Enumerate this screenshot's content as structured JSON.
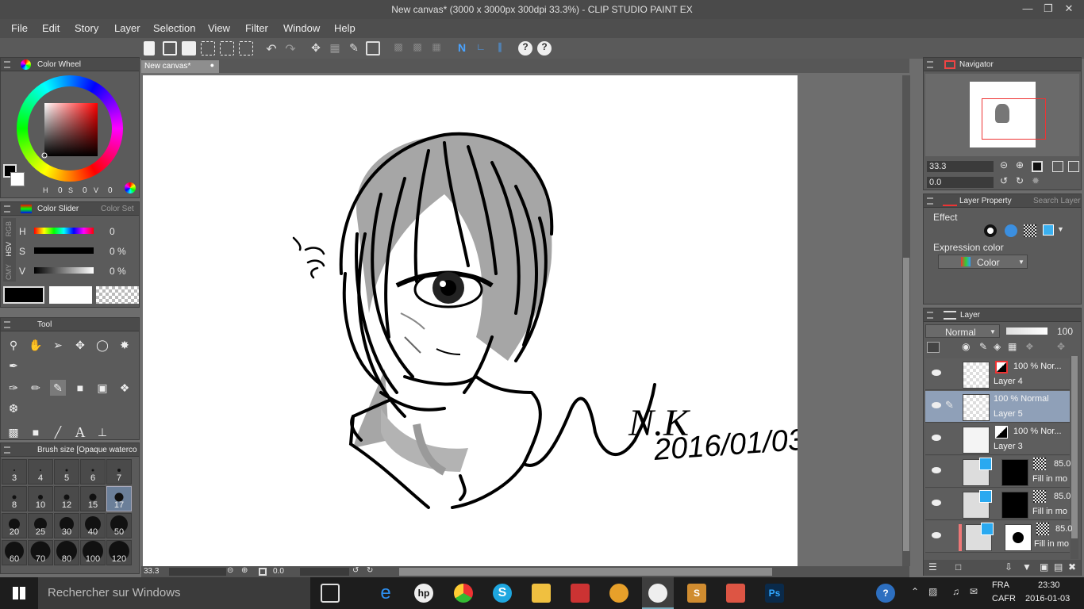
{
  "window": {
    "title": "New canvas* (3000 x 3000px 300dpi 33.3%)  - CLIP STUDIO PAINT EX"
  },
  "menu": [
    "File",
    "Edit",
    "Story",
    "Layer",
    "Selection",
    "View",
    "Filter",
    "Window",
    "Help"
  ],
  "canvas_tab": {
    "label": "New canvas*"
  },
  "color_wheel": {
    "title": "Color Wheel",
    "h_label": "H",
    "h": "0",
    "s_label": "S",
    "s": "0",
    "v_label": "V",
    "v": "0"
  },
  "color_slider": {
    "title": "Color Slider",
    "alt_tab": "Color Set",
    "side_tabs": [
      "RGB",
      "HSV",
      "CMY"
    ],
    "rows": [
      {
        "label": "H",
        "value": "0"
      },
      {
        "label": "S",
        "value": "0 %"
      },
      {
        "label": "V",
        "value": "0 %"
      }
    ]
  },
  "tool_panel": {
    "title": "Tool"
  },
  "brush_size": {
    "title": "Brush size [Opaque watercolor]",
    "sizes": [
      "3",
      "4",
      "5",
      "6",
      "7",
      "8",
      "10",
      "12",
      "15",
      "17",
      "20",
      "25",
      "30",
      "40",
      "50",
      "60",
      "70",
      "80",
      "100",
      "120"
    ],
    "selected": "17"
  },
  "canvas_status": {
    "zoom": "33.3",
    "angle": "0.0"
  },
  "drawing_text": {
    "signature": "N.K",
    "date": "2016/01/03"
  },
  "navigator": {
    "title": "Navigator",
    "zoom": "33.3",
    "angle": "0.0"
  },
  "layer_property": {
    "title": "Layer Property",
    "alt_tab": "Search Layer",
    "effect_label": "Effect",
    "expr_label": "Expression color",
    "expr_value": "Color"
  },
  "layer_panel": {
    "title": "Layer",
    "blend": "Normal",
    "opacity": "100"
  },
  "layers": [
    {
      "top": "100 %  Nor...",
      "name": "Layer 4"
    },
    {
      "top": "100 %  Normal",
      "name": "Layer 5"
    },
    {
      "top": "100 %  Nor...",
      "name": "Layer 3"
    },
    {
      "top": "85.0",
      "name": "Fill in mo"
    },
    {
      "top": "85.0",
      "name": "Fill in mo"
    },
    {
      "top": "85.0",
      "name": "Fill in mo"
    }
  ],
  "taskbar": {
    "search": "Rechercher sur Windows",
    "lang1": "FRA",
    "lang2": "CAFR",
    "time": "23:30",
    "date": "2016-01-03"
  },
  "colors": {
    "accent_layer": "#8fa0b8",
    "selected_cell": "#6b7f99"
  }
}
